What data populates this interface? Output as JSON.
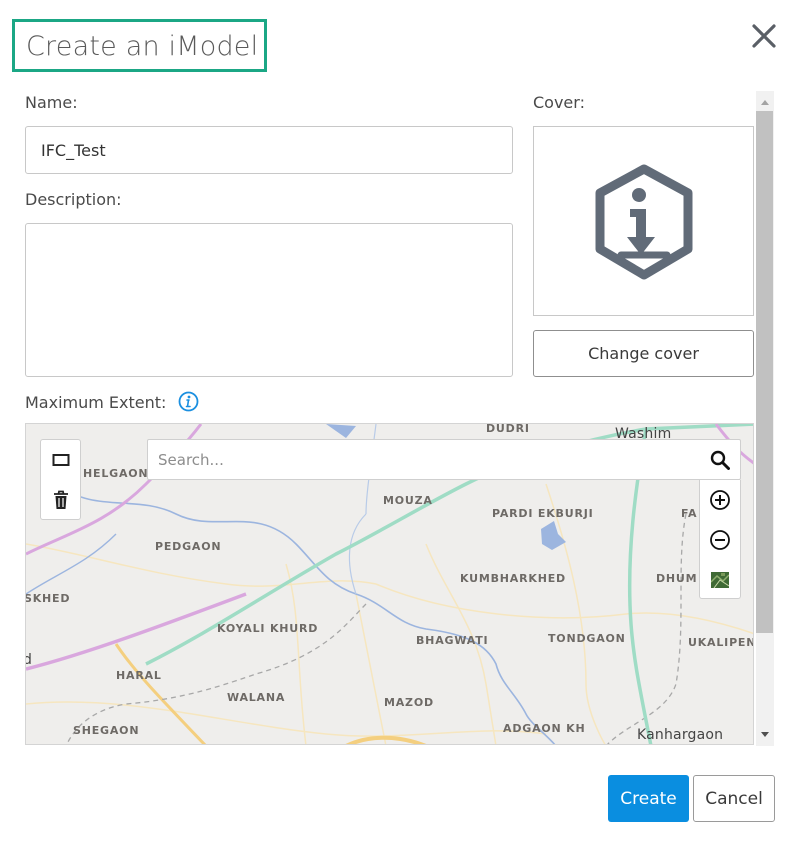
{
  "dialog": {
    "title": "Create an iModel",
    "accent_color": "#1ba785"
  },
  "form": {
    "name_label": "Name:",
    "name_value": "IFC_Test",
    "description_label": "Description:",
    "description_value": "",
    "cover_label": "Cover:",
    "cover_icon": "imodel-hexagon-info-icon",
    "change_cover_label": "Change cover",
    "extent_label": "Maximum Extent:"
  },
  "map": {
    "search_placeholder": "Search...",
    "places": [
      "DUDRI",
      "Washim",
      "HELGAON",
      "MOUZA",
      "PARDI EKBURJI",
      "FA",
      "PEDGAON",
      "KUMBHARKHED",
      "DHUM",
      "SKHED",
      "KOYALI KHURD",
      "BHAGWATI",
      "TONDGAON",
      "UKALIPEN",
      "d",
      "HARAL",
      "WALANA",
      "MAZOD",
      "SHEGAON",
      "ADGAON KH",
      "Kanhargaon"
    ]
  },
  "footer": {
    "create_label": "Create",
    "cancel_label": "Cancel",
    "primary_color": "#0a8ee0"
  }
}
